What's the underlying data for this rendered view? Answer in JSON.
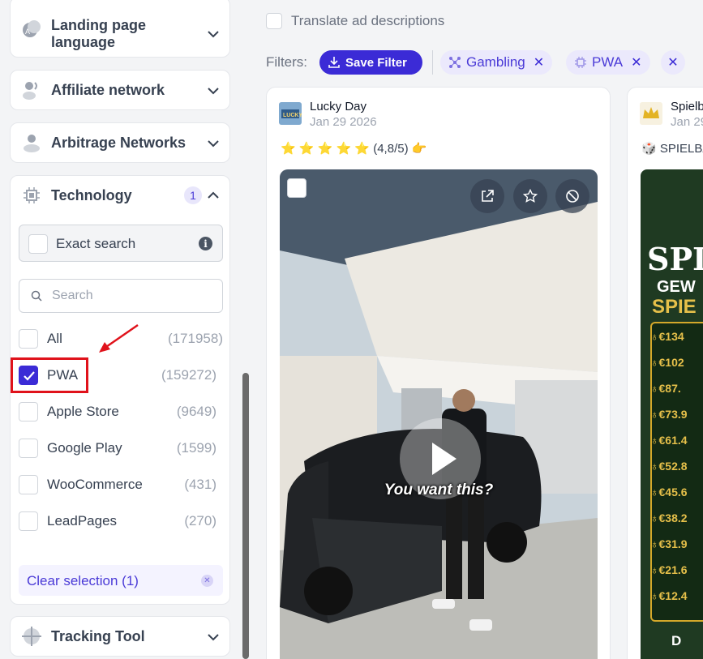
{
  "sidebar": {
    "landing_language": {
      "label": "Landing page language"
    },
    "affiliate_network": {
      "label": "Affiliate network"
    },
    "arbitrage_networks": {
      "label": "Arbitrage Networks"
    },
    "technology": {
      "label": "Technology",
      "badge": "1",
      "exact_search_label": "Exact search",
      "search_placeholder": "Search",
      "options": [
        {
          "label": "All",
          "count": "(171958)",
          "checked": false
        },
        {
          "label": "PWA",
          "count": "(159272)",
          "checked": true
        },
        {
          "label": "Apple Store",
          "count": "(9649)",
          "checked": false
        },
        {
          "label": "Google Play",
          "count": "(1599)",
          "checked": false
        },
        {
          "label": "WooCommerce",
          "count": "(431)",
          "checked": false
        },
        {
          "label": "LeadPages",
          "count": "(270)",
          "checked": false
        }
      ],
      "clear_label": "Clear selection (1)"
    },
    "tracking_tool": {
      "label": "Tracking Tool"
    }
  },
  "main": {
    "translate_label": "Translate ad descriptions",
    "filters_label": "Filters:",
    "save_filter_label": "Save Filter",
    "chips": [
      {
        "label": "Gambling",
        "icon": "network-icon"
      },
      {
        "label": "PWA",
        "icon": "chip-icon"
      }
    ]
  },
  "ads": [
    {
      "advertiser": "Lucky Day",
      "date": "Jan 29 2026",
      "text": "⭐ ⭐ ⭐ ⭐ ⭐ (4,8/5) 👉",
      "caption": "You want this?"
    },
    {
      "advertiser": "Spielb",
      "date": "Jan 29",
      "text": "🎲 SPIELBA",
      "creative": {
        "title": "SPI",
        "line1": "GEW",
        "line2": "SPIE",
        "prizes": [
          "♁€134",
          "♁€102",
          "♁€87.",
          "♁€73.9",
          "♁€61.4",
          "♁€52.8",
          "♁€45.6",
          "♁€38.2",
          "♁€31.9",
          "♁€21.6",
          "♁€12.4"
        ],
        "bottom": "D"
      }
    }
  ],
  "colors": {
    "accent": "#3b2bd6",
    "highlight": "#e0121b"
  }
}
